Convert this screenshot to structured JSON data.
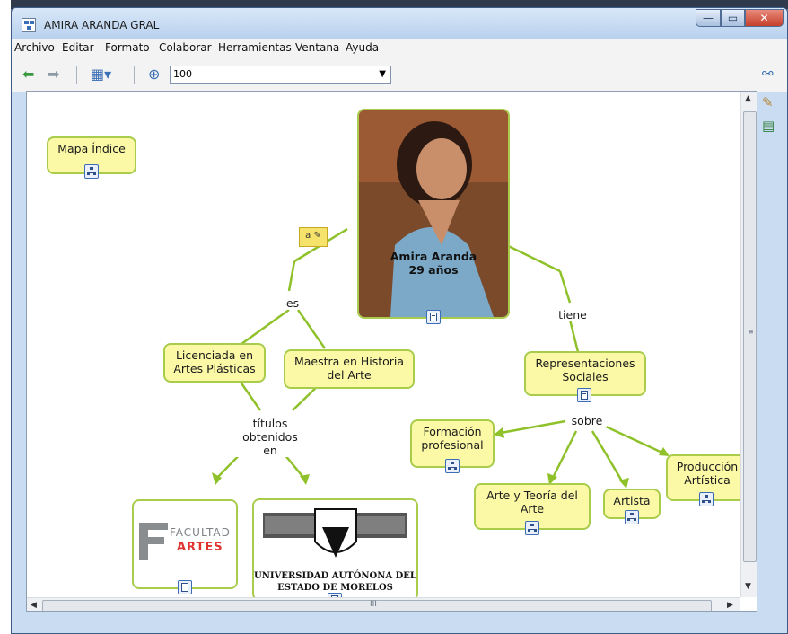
{
  "window": {
    "title": "AMIRA ARANDA GRAL",
    "min_symbol": "—",
    "max_symbol": "▭",
    "close_symbol": "✕"
  },
  "menu": [
    "Archivo",
    "Editar",
    "Formato",
    "Colaborar",
    "Herramientas",
    "Ventana",
    "Ayuda"
  ],
  "toolbar": {
    "zoom_value": "100"
  },
  "icons": {
    "back": "back-arrow-icon",
    "forward": "forward-arrow-icon",
    "view": "view-options-icon",
    "zoom": "zoom-icon",
    "side": [
      "network-icon",
      "brush-icon",
      "notes-icon"
    ]
  },
  "concept_map": {
    "center": {
      "name": "Amira Aranda",
      "age": "29 años"
    },
    "index": "Mapa Índice",
    "links": {
      "es": "es",
      "tiene": "tiene",
      "titulos": [
        "títulos",
        "obtenidos",
        "en"
      ],
      "sobre": "sobre"
    },
    "nodes": {
      "licenciada": [
        "Licenciada en",
        "Artes Plásticas"
      ],
      "maestra": [
        "Maestra en Historia",
        "del Arte"
      ],
      "representaciones": [
        "Representaciones",
        "Sociales"
      ],
      "formacion": [
        "Formación",
        "profesional"
      ],
      "produccion": [
        "Producción",
        "Artística"
      ],
      "arte_teoria": [
        "Arte y Teoría del",
        "Arte"
      ],
      "artista": "Artista"
    },
    "facultad_logo": {
      "line1": "FACULTAD",
      "line2": "ARTES"
    },
    "uaem_logo": {
      "line1": "UNIVERSIDAD AUTÓNONA DEL",
      "line2": "ESTADO DE MORELOS"
    },
    "annotation_icon": "a"
  },
  "colors": {
    "node_fill": "#fbf9a6",
    "node_border": "#a9cc4d",
    "link_line": "#8fc12a"
  },
  "scrollbars": {
    "grip_v": "≡",
    "grip_h": "III"
  }
}
